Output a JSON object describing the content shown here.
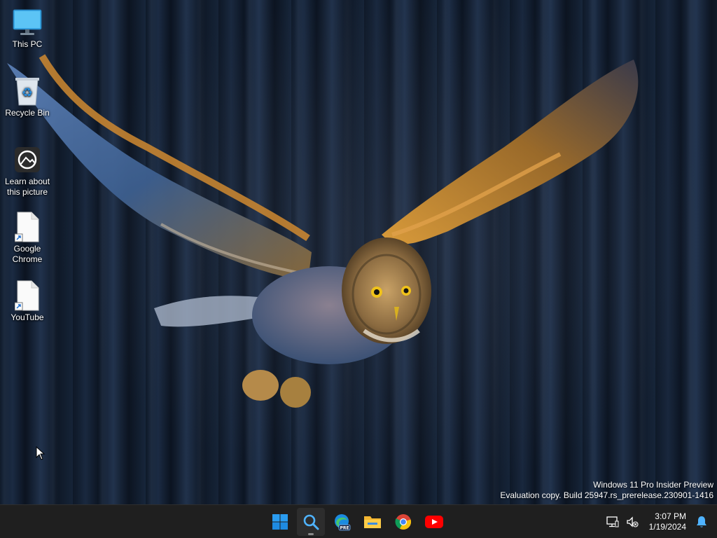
{
  "desktop_icons": [
    {
      "name": "this-pc",
      "label": "This PC"
    },
    {
      "name": "recycle-bin",
      "label": "Recycle Bin"
    },
    {
      "name": "learn-about-this-picture",
      "label": "Learn about this picture"
    },
    {
      "name": "google-chrome",
      "label": "Google Chrome"
    },
    {
      "name": "youtube",
      "label": "YouTube"
    }
  ],
  "watermark": {
    "line1": "Windows 11 Pro Insider Preview",
    "line2": "Evaluation copy. Build 25947.rs_prerelease.230901-1416"
  },
  "taskbar": {
    "apps": [
      {
        "name": "start-button",
        "icon": "windows-logo-icon"
      },
      {
        "name": "search-button",
        "icon": "search-icon"
      },
      {
        "name": "edge-preview-button",
        "icon": "edge-icon",
        "badge": "PRE"
      },
      {
        "name": "file-explorer-button",
        "icon": "folder-icon"
      },
      {
        "name": "chrome-button",
        "icon": "chrome-icon"
      },
      {
        "name": "youtube-button",
        "icon": "youtube-icon"
      }
    ],
    "tray": {
      "time": "3:07 PM",
      "date": "1/19/2024"
    }
  },
  "colors": {
    "taskbar_bg": "#1f1f1f",
    "accent_blue": "#0078d4",
    "youtube_red": "#ff0000"
  }
}
